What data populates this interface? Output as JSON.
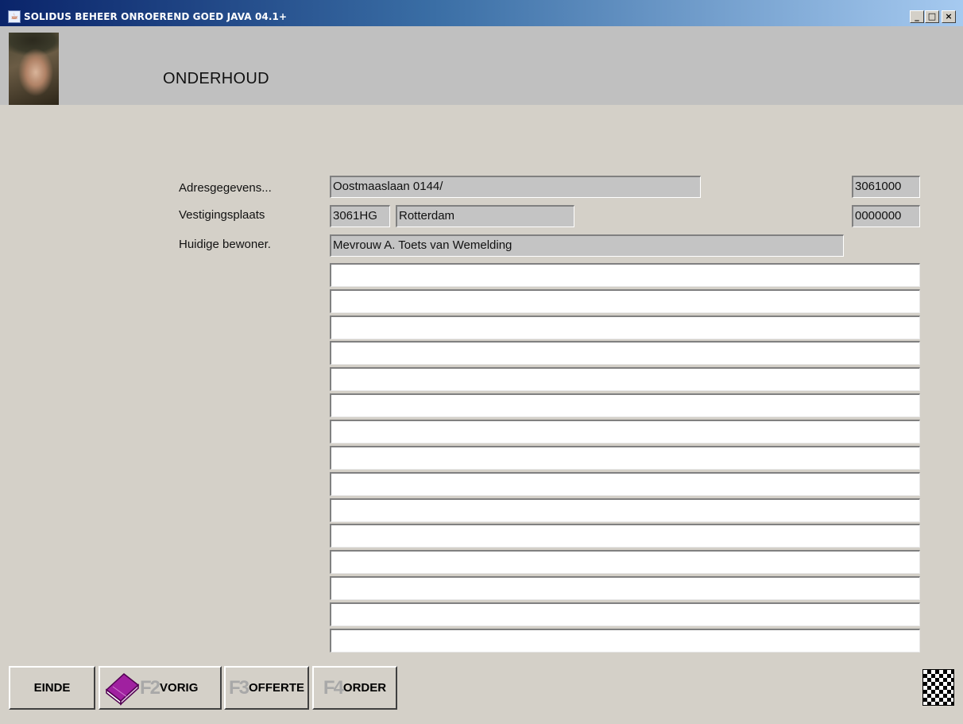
{
  "window": {
    "title": "SOLIDUS BEHEER ONROEREND GOED JAVA 04.1+",
    "minimize": "_",
    "maximize": "□",
    "close": "×",
    "app_icon": "java-cup-icon"
  },
  "header": {
    "title": "ONDERHOUD",
    "photo": "portrait-photo"
  },
  "form": {
    "address_label": "Adresgegevens...",
    "address_value": "Oostmaaslaan 0144/",
    "address_code": "3061000",
    "city_label": "Vestigingsplaats",
    "postcode": "3061HG",
    "city": "Rotterdam",
    "city_code": "0000000",
    "resident_label": "Huidige bewoner.",
    "resident": "Mevrouw A. Toets van Wemelding"
  },
  "lines": [
    "",
    "",
    "",
    "",
    "",
    "",
    "",
    "",
    "",
    "",
    "",
    "",
    "",
    "",
    ""
  ],
  "buttons": {
    "einde": "EINDE",
    "vorig_key": "F2",
    "vorig": "VORIG",
    "offerte_key": "F3",
    "offerte": "OFFERTE",
    "order_key": "F4",
    "order": "ORDER"
  },
  "icons": {
    "book": "book-icon",
    "pattern": "checker-icon"
  }
}
